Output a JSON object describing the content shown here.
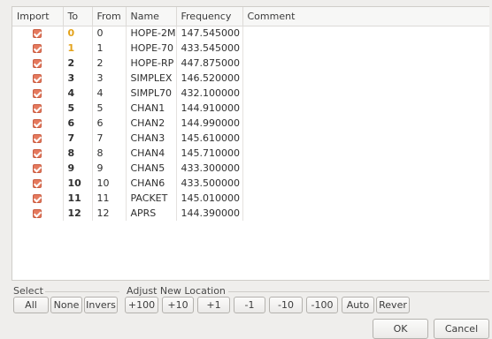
{
  "table": {
    "columns": [
      "Import",
      "To",
      "From",
      "Name",
      "Frequency",
      "Comment"
    ],
    "rows": [
      {
        "to": "0",
        "from": "0",
        "name": "HOPE-2M",
        "frequency": "147.545000",
        "comment": ""
      },
      {
        "to": "1",
        "from": "1",
        "name": "HOPE-70",
        "frequency": "433.545000",
        "comment": ""
      },
      {
        "to": "2",
        "from": "2",
        "name": "HOPE-RP",
        "frequency": "447.875000",
        "comment": ""
      },
      {
        "to": "3",
        "from": "3",
        "name": "SIMPLEX",
        "frequency": "146.520000",
        "comment": ""
      },
      {
        "to": "4",
        "from": "4",
        "name": "SIMPL70",
        "frequency": "432.100000",
        "comment": ""
      },
      {
        "to": "5",
        "from": "5",
        "name": "CHAN1",
        "frequency": "144.910000",
        "comment": ""
      },
      {
        "to": "6",
        "from": "6",
        "name": "CHAN2",
        "frequency": "144.990000",
        "comment": ""
      },
      {
        "to": "7",
        "from": "7",
        "name": "CHAN3",
        "frequency": "145.610000",
        "comment": ""
      },
      {
        "to": "8",
        "from": "8",
        "name": "CHAN4",
        "frequency": "145.710000",
        "comment": ""
      },
      {
        "to": "9",
        "from": "9",
        "name": "CHAN5",
        "frequency": "433.300000",
        "comment": ""
      },
      {
        "to": "10",
        "from": "10",
        "name": "CHAN6",
        "frequency": "433.500000",
        "comment": ""
      },
      {
        "to": "11",
        "from": "11",
        "name": "PACKET",
        "frequency": "145.010000",
        "comment": ""
      },
      {
        "to": "12",
        "from": "12",
        "name": "APRS",
        "frequency": "144.390000",
        "comment": ""
      }
    ]
  },
  "select_group": {
    "title": "Select",
    "all_label": "All",
    "none_label": "None",
    "inverse_label": "Invers"
  },
  "adjust_group": {
    "title": "Adjust New Location",
    "plus100_label": "+100",
    "plus10_label": "+10",
    "plus1_label": "+1",
    "minus1_label": "-1",
    "minus10_label": "-10",
    "minus100_label": "-100",
    "auto_label": "Auto",
    "revert_label": "Rever"
  },
  "dialog_buttons": {
    "ok_label": "OK",
    "cancel_label": "Cancel"
  },
  "colors": {
    "checkbox": "#e57a5e",
    "conflict_to": "#e3a21a"
  }
}
